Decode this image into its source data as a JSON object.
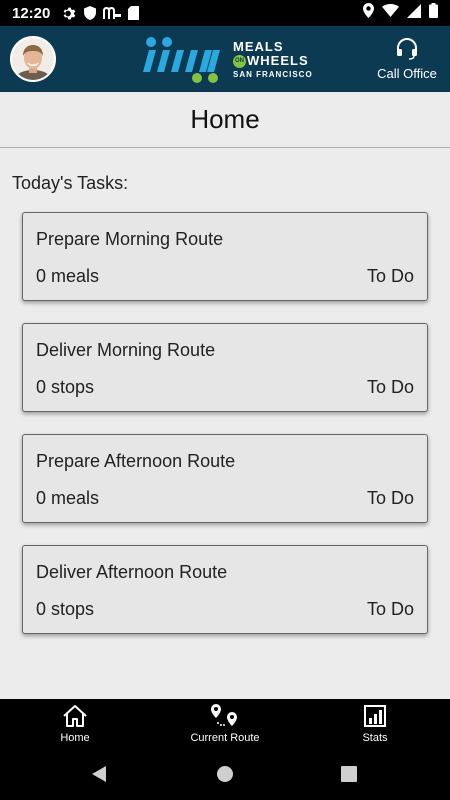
{
  "status_bar": {
    "time": "12:20",
    "left_icons": [
      "gear-icon",
      "shield-icon",
      "mcdonalds-icon",
      "sd-card-icon"
    ],
    "right_icons": [
      "location-icon",
      "wifi-icon",
      "signal-icon",
      "battery-icon"
    ]
  },
  "header": {
    "logo": {
      "line1": "MEALS",
      "on": "ON",
      "line2": "WHEELS",
      "line3": "SAN FRANCISCO",
      "tm": "™"
    },
    "call_office_label": "Call Office",
    "colors": {
      "header_bg": "#0b3a52",
      "logo_blue": "#29a9e0",
      "logo_green": "#84c341"
    }
  },
  "page": {
    "title": "Home",
    "section_label": "Today's Tasks:"
  },
  "tasks": [
    {
      "title": "Prepare Morning Route",
      "count": "0 meals",
      "status": "To Do"
    },
    {
      "title": "Deliver Morning Route",
      "count": "0 stops",
      "status": "To Do"
    },
    {
      "title": "Prepare Afternoon Route",
      "count": "0 meals",
      "status": "To Do"
    },
    {
      "title": "Deliver Afternoon Route",
      "count": "0 stops",
      "status": "To Do"
    }
  ],
  "bottom_nav": {
    "items": [
      {
        "label": "Home",
        "icon": "home-icon"
      },
      {
        "label": "Current Route",
        "icon": "route-pins-icon"
      },
      {
        "label": "Stats",
        "icon": "stats-chart-icon"
      }
    ]
  },
  "system_nav": [
    "back-icon",
    "home-circle-icon",
    "recents-icon"
  ]
}
